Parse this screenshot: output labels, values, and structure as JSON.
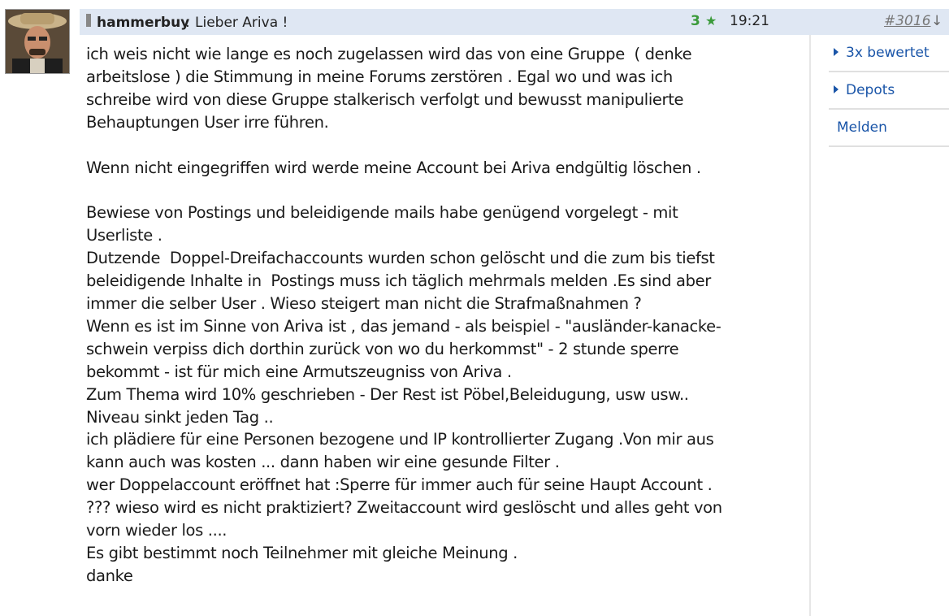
{
  "post": {
    "username": "hammerbuy",
    "separator": ":",
    "title": "Lieber Ariva !",
    "rating_count": "3",
    "star_glyph": "★",
    "time": "19:21",
    "post_number": "#3016",
    "jump_arrow": "↓",
    "body": "ich weis nicht wie lange es noch zugelassen wird das von eine Gruppe  ( denke\narbeitslose ) die Stimmung in meine Forums zerstören . Egal wo und was ich\nschreibe wird von diese Gruppe stalkerisch verfolgt und bewusst manipulierte\nBehauptungen User irre führen.\n\nWenn nicht eingegriffen wird werde meine Account bei Ariva endgültig löschen .\n\nBewiese von Postings und beleidigende mails habe genügend vorgelegt - mit\nUserliste .\nDutzende  Doppel-Dreifachaccounts wurden schon gelöscht und die zum bis tiefst\nbeleidigende Inhalte in  Postings muss ich täglich mehrmals melden .Es sind aber\nimmer die selber User . Wieso steigert man nicht die Strafmaßnahmen ?\nWenn es ist im Sinne von Ariva ist , das jemand - als beispiel - \"ausländer-kanacke-\nschwein verpiss dich dorthin zurück von wo du herkommst\" - 2 stunde sperre\nbekommt - ist für mich eine Armutszeugniss von Ariva .\nZum Thema wird 10% geschrieben - Der Rest ist Pöbel,Beleidugung, usw usw..\nNiveau sinkt jeden Tag ..\nich plädiere für eine Personen bezogene und IP kontrollierter Zugang .Von mir aus\nkann auch was kosten ... dann haben wir eine gesunde Filter .\nwer Doppelaccount eröffnet hat :Sperre für immer auch für seine Haupt Account .\n??? wieso wird es nicht praktiziert? Zweitaccount wird geslöscht und alles geht von\nvorn wieder los ....\nEs gibt bestimmt noch Teilnehmer mit gleiche Meinung .\ndanke"
  },
  "sidebar": {
    "items": [
      {
        "label": "3x bewertet"
      },
      {
        "label": "Depots"
      },
      {
        "label": "Melden"
      }
    ]
  },
  "colors": {
    "header_bg": "#dfe7f3",
    "link_blue": "#1a55a8",
    "rating_green": "#3a9a3a"
  },
  "icons": {
    "avatar": "user-avatar-photo",
    "star": "star-icon",
    "arrow": "arrow-down-icon",
    "triangle": "triangle-right-icon"
  }
}
